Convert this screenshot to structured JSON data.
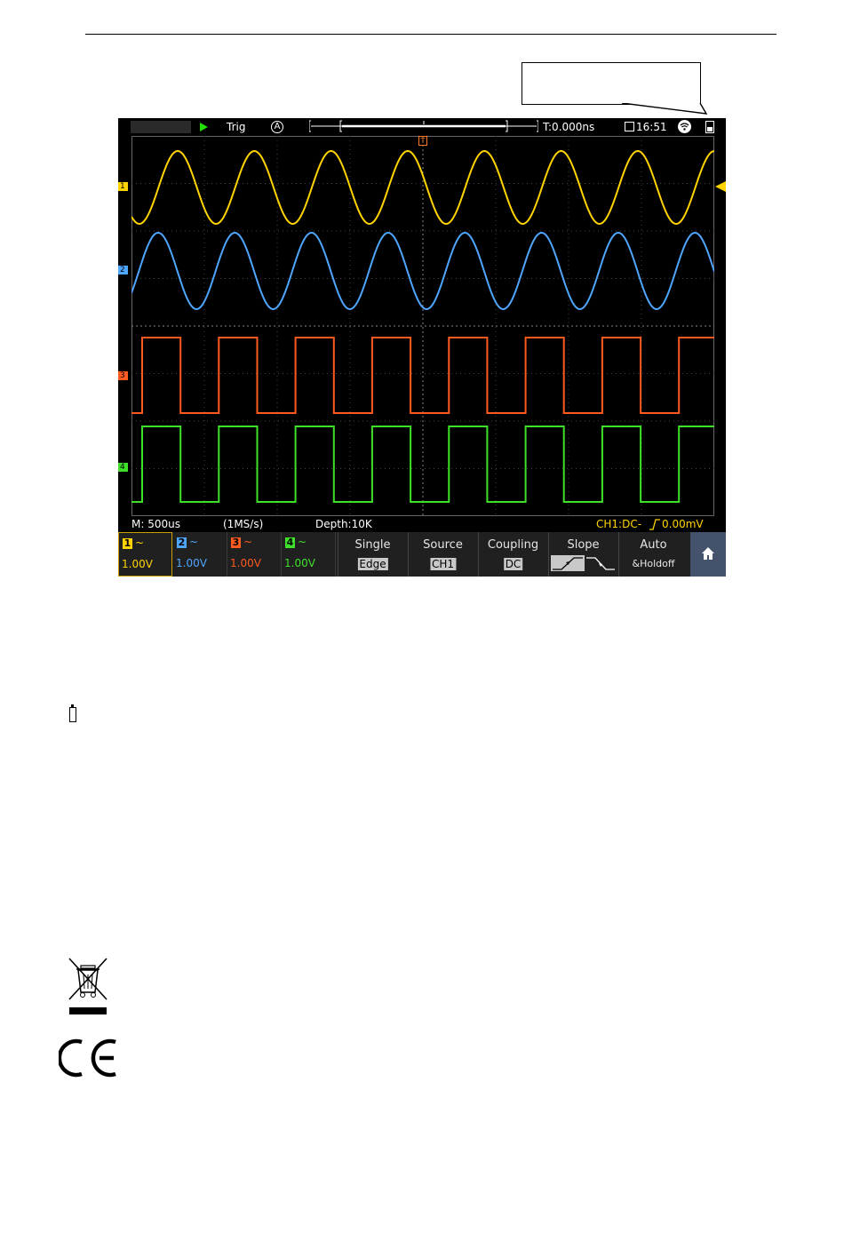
{
  "scope": {
    "status": {
      "trigger_state": "Trig",
      "auto_symbol": "A",
      "trigger_time": "T:0.000ns",
      "clock": "16:51"
    },
    "bottom_status": {
      "timebase": "M: 500us",
      "sample_rate": "(1MS/s)",
      "depth": "Depth:10K",
      "trigger_info": "CH1:DC-",
      "trigger_level": "0.00mV"
    },
    "channels": [
      {
        "num": "1",
        "coupling": "~",
        "scale": "1.00V",
        "color": "#ffd400",
        "active": true,
        "marker": "1"
      },
      {
        "num": "2",
        "coupling": "~",
        "scale": "1.00V",
        "color": "#4fa6ff",
        "active": false,
        "marker": "2"
      },
      {
        "num": "3",
        "coupling": "~",
        "scale": "1.00V",
        "color": "#ff5a1f",
        "active": false,
        "marker": "3"
      },
      {
        "num": "4",
        "coupling": "~",
        "scale": "1.00V",
        "color": "#3fe02a",
        "active": false,
        "marker": "4"
      }
    ],
    "menu": {
      "single": {
        "label": "Single",
        "value": "Edge"
      },
      "source": {
        "label": "Source",
        "value": "CH1"
      },
      "coupling": {
        "label": "Coupling",
        "value": "DC"
      },
      "slope": {
        "label": "Slope"
      },
      "auto": {
        "label": "Auto",
        "value": "&Holdoff"
      }
    },
    "trigger_marker": "T",
    "colors": {
      "ch1": "#ffd400",
      "ch2": "#4fa6ff",
      "ch3": "#ff5a1f",
      "ch4": "#3fe02a",
      "menu_bg": "#202020",
      "home": "#45526b"
    }
  },
  "icons": [
    "play-icon",
    "lock-icon",
    "wifi-icon",
    "battery-icon",
    "home-icon",
    "weee-bin-icon",
    "ce-mark-icon"
  ]
}
